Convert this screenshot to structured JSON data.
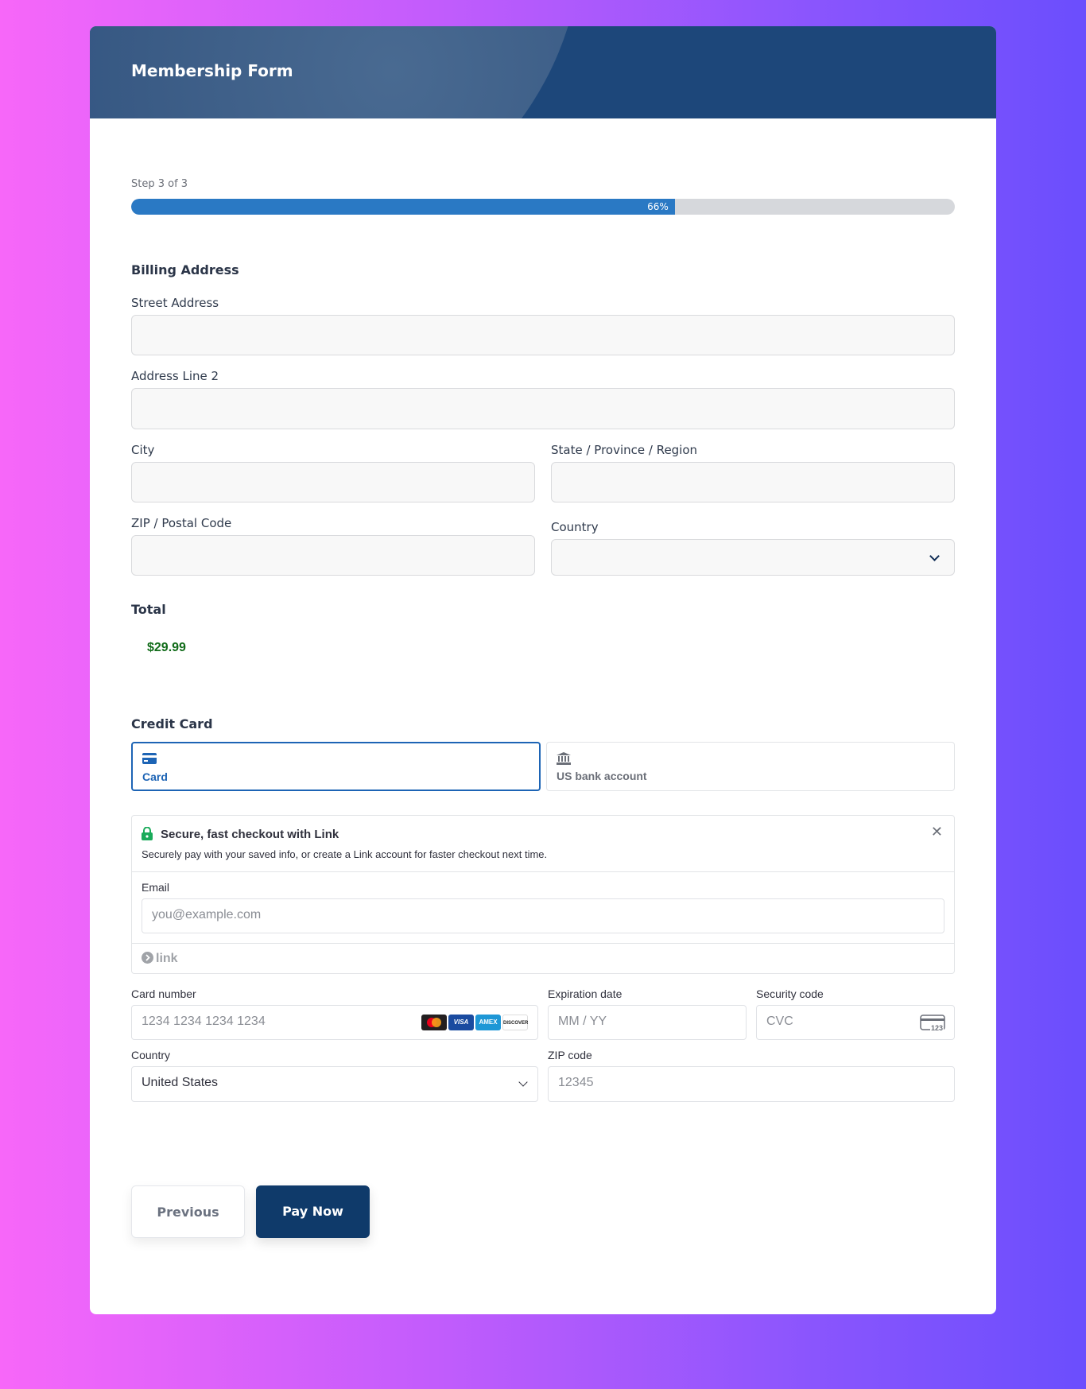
{
  "header": {
    "title": "Membership Form"
  },
  "progress": {
    "step_label": "Step 3 of 3",
    "percent": 66,
    "percent_label": "66%"
  },
  "billing": {
    "title": "Billing Address",
    "street_label": "Street Address",
    "address2_label": "Address Line 2",
    "city_label": "City",
    "state_label": "State / Province / Region",
    "zip_label": "ZIP / Postal Code",
    "country_label": "Country"
  },
  "total": {
    "title": "Total",
    "amount": "$29.99"
  },
  "payment": {
    "title": "Credit Card",
    "tabs": [
      {
        "label": "Card",
        "icon": "credit-card-icon",
        "active": true
      },
      {
        "label": "US bank account",
        "icon": "bank-icon",
        "active": false
      }
    ],
    "link": {
      "title": "Secure, fast checkout with Link",
      "description": "Securely pay with your saved info, or create a Link account for faster checkout next time.",
      "email_label": "Email",
      "email_placeholder": "you@example.com",
      "footer_label": "link"
    },
    "card_number_label": "Card number",
    "card_number_placeholder": "1234 1234 1234 1234",
    "brands": [
      "mastercard",
      "VISA",
      "AMEX",
      "DISCOVER"
    ],
    "expiry_label": "Expiration date",
    "expiry_placeholder": "MM / YY",
    "cvc_label": "Security code",
    "cvc_placeholder": "CVC",
    "cvc_icon_text": "123",
    "country_label": "Country",
    "country_value": "United States",
    "zip_label": "ZIP code",
    "zip_placeholder": "12345"
  },
  "actions": {
    "previous": "Previous",
    "pay": "Pay Now"
  },
  "colors": {
    "primary": "#0f3a6a",
    "progress": "#2a79c4",
    "accent_blue": "#1d64b5",
    "total_green": "#126c1a"
  }
}
